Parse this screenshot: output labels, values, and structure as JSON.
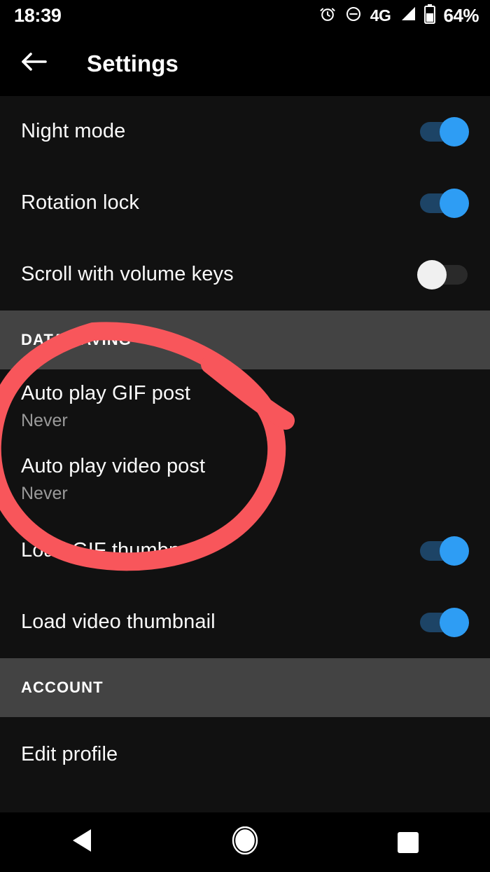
{
  "status_bar": {
    "clock": "18:39",
    "battery_percent": "64%",
    "network_type": "4G",
    "icons": [
      "alarm-icon",
      "do-not-disturb-icon",
      "signal-icon",
      "battery-icon"
    ]
  },
  "toolbar": {
    "title": "Settings",
    "back_icon": "back-arrow-icon"
  },
  "colors": {
    "background": "#111111",
    "toolbar_background": "#000000",
    "section_header_background": "#434343",
    "toggle_on_thumb": "#2e9df4",
    "toggle_on_track": "#1d4466",
    "toggle_off_thumb": "#f0f0f0",
    "toggle_off_track": "#2a2a2a",
    "primary_text": "#fafafa",
    "secondary_text": "#9a9a9a",
    "annotation": "#f8565b"
  },
  "list": {
    "rows": [
      {
        "type": "toggle",
        "label": "Night mode",
        "toggle": "on"
      },
      {
        "type": "toggle",
        "label": "Rotation lock",
        "toggle": "on"
      },
      {
        "type": "toggle",
        "label": "Scroll with volume keys",
        "toggle": "off"
      }
    ],
    "section_data_saving": {
      "header": "DATA SAVING",
      "rows": [
        {
          "type": "twoline",
          "label": "Auto play GIF post",
          "value": "Never"
        },
        {
          "type": "twoline",
          "label": "Auto play video post",
          "value": "Never"
        },
        {
          "type": "toggle",
          "label": "Load GIF thumbnail",
          "toggle": "on"
        },
        {
          "type": "toggle",
          "label": "Load video thumbnail",
          "toggle": "on"
        }
      ]
    },
    "section_account": {
      "header": "ACCOUNT",
      "rows": [
        {
          "type": "simple",
          "label": "Edit profile"
        }
      ]
    }
  },
  "nav_bar": {
    "back": "nav-back-icon",
    "home": "nav-home-icon",
    "recents": "nav-recents-icon"
  },
  "annotation": {
    "description": "hand-drawn red circle around the Auto play GIF post and Auto play video post rows with a tail stroke",
    "color": "#f8565b"
  }
}
